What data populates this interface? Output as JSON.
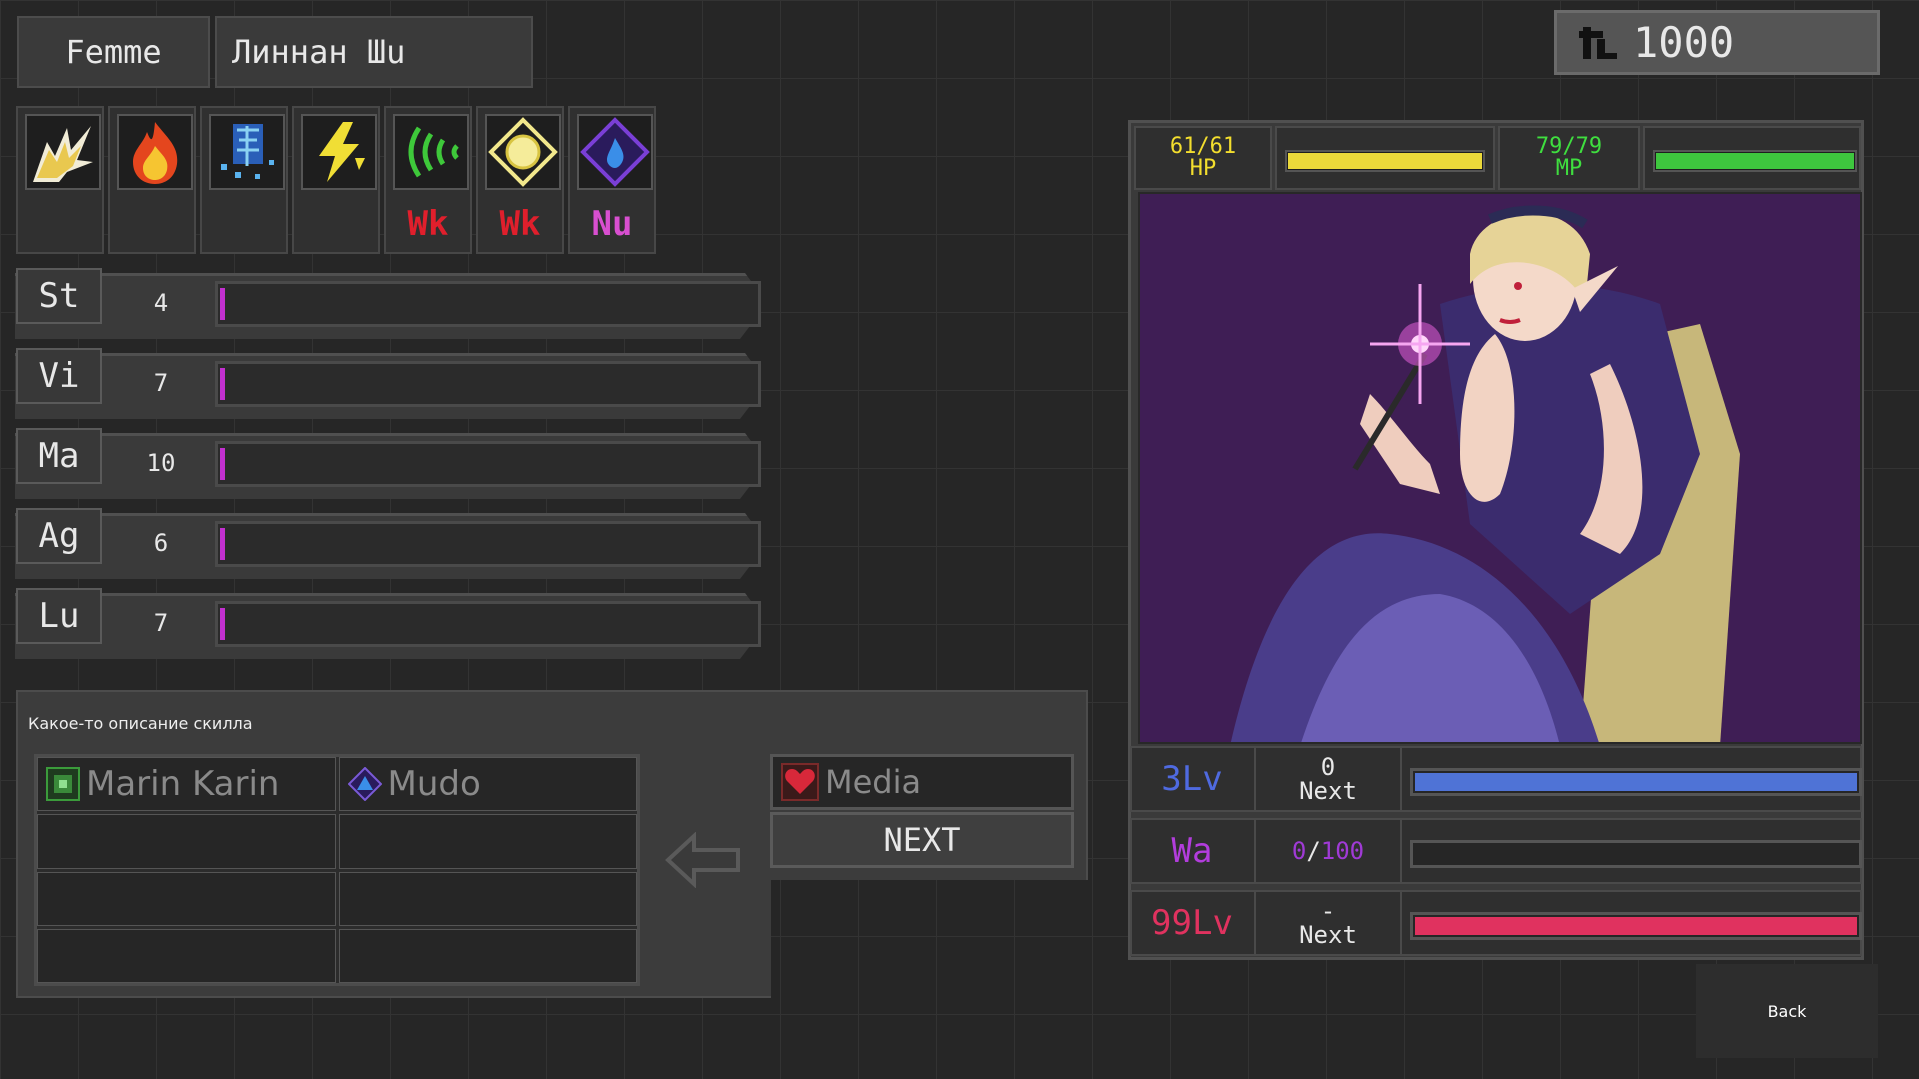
{
  "header": {
    "gender": "Femme",
    "name": "Линнан Шu"
  },
  "currency": {
    "icon": "macca-coin-icon",
    "amount": "1000"
  },
  "affinities": [
    {
      "element": "physical",
      "resist": ""
    },
    {
      "element": "fire",
      "resist": ""
    },
    {
      "element": "ice",
      "resist": ""
    },
    {
      "element": "electric",
      "resist": ""
    },
    {
      "element": "force",
      "resist": "Wk"
    },
    {
      "element": "light",
      "resist": "Wk"
    },
    {
      "element": "dark",
      "resist": "Nu"
    }
  ],
  "stats": [
    {
      "label": "St",
      "value": "4",
      "fill": 0.01
    },
    {
      "label": "Vi",
      "value": "7",
      "fill": 0.01
    },
    {
      "label": "Ma",
      "value": "10",
      "fill": 0.01
    },
    {
      "label": "Ag",
      "value": "6",
      "fill": 0.01
    },
    {
      "label": "Lu",
      "value": "7",
      "fill": 0.01
    }
  ],
  "skill_panel": {
    "description": "Какое-то описание скилла",
    "skills": [
      {
        "name": "Marin Karin",
        "icon": "ailment-icon"
      },
      {
        "name": "Mudo",
        "icon": "dark-skill-icon"
      },
      {
        "name": ""
      },
      {
        "name": ""
      },
      {
        "name": ""
      },
      {
        "name": ""
      },
      {
        "name": ""
      },
      {
        "name": ""
      }
    ],
    "new_skill": {
      "name": "Media",
      "icon": "heal-heart-icon"
    },
    "next_label": "NEXT"
  },
  "vitals": {
    "hp": {
      "current": "61",
      "max": "61",
      "label": "HP",
      "fill": 1.0,
      "color": "#ebd93a"
    },
    "mp": {
      "current": "79",
      "max": "79",
      "label": "MP",
      "fill": 1.0,
      "color": "#3ec63e"
    }
  },
  "levels": [
    {
      "level": "3Lv",
      "top_text": "0",
      "bottom_text": "Next",
      "color": "#4f6ae0",
      "bar_color": "#4f73d6",
      "fill": 1.0
    },
    {
      "level": "Wa",
      "top_text": "0",
      "sep": "/",
      "max": "100",
      "color": "#b23ddc",
      "bar_color": "#444",
      "fill": 0.0
    },
    {
      "level": "99Lv",
      "top_text": "-",
      "bottom_text": "Next",
      "color": "#e0325f",
      "bar_color": "#e0325f",
      "fill": 1.0
    }
  ],
  "back_label": "Back"
}
